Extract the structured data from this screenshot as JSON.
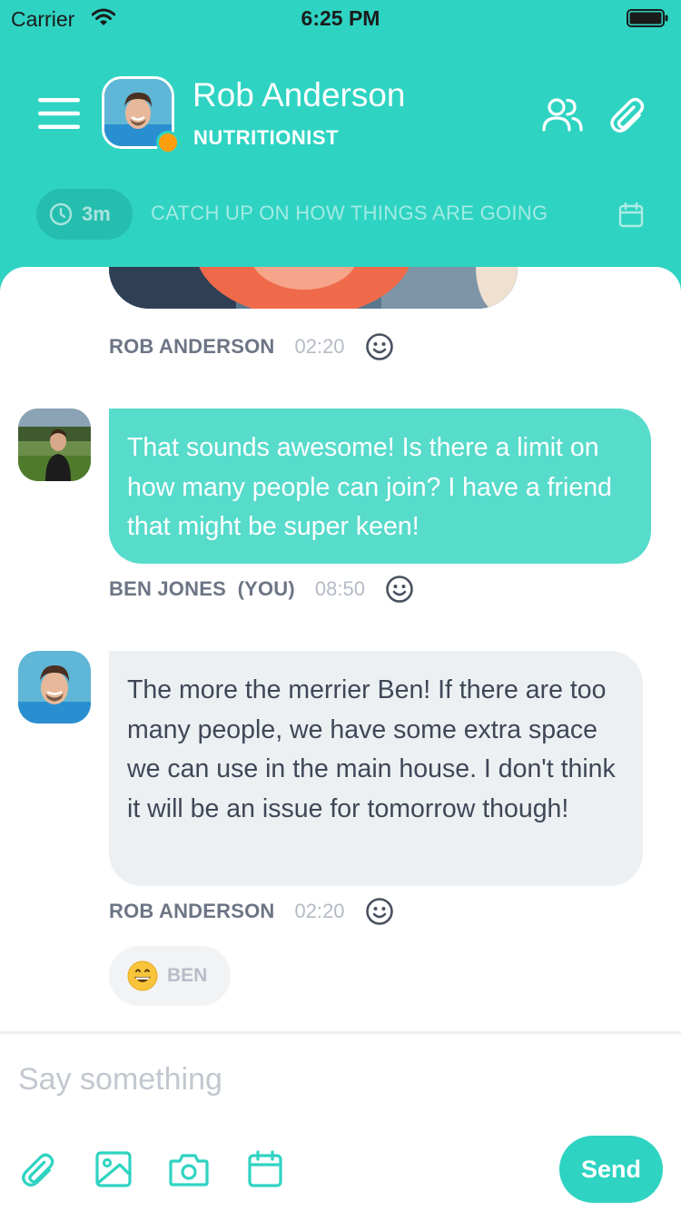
{
  "status_bar": {
    "carrier": "Carrier",
    "time": "6:25 PM"
  },
  "header": {
    "contact_name": "Rob Anderson",
    "contact_role": "NUTRITIONIST",
    "online_status_color": "#ff9f0f",
    "session": {
      "timer": "3m",
      "topic": "CATCH UP ON HOW THINGS ARE GOING"
    }
  },
  "colors": {
    "accent": "#2fd3c2",
    "my_bubble": "#57dbcb",
    "their_bubble": "#edf0f3"
  },
  "messages": [
    {
      "type": "image",
      "author": "ROB ANDERSON",
      "time": "02:20"
    },
    {
      "type": "text",
      "author": "BEN JONES  (YOU)",
      "time": "08:50",
      "text": "That sounds awesome! Is there a limit on how many people can join? I have a friend that might be super keen!"
    },
    {
      "type": "text",
      "author": "ROB ANDERSON",
      "time": "02:20",
      "text": "The more the merrier Ben! If there are too many people, we have some extra space we can use in the main house. I don't think it will be an issue for tomorrow though!",
      "reaction": {
        "emoji": "grinning-face",
        "by": "BEN"
      }
    }
  ],
  "composer": {
    "placeholder": "Say something",
    "send_label": "Send"
  },
  "icons": [
    "menu-icon",
    "people-icon",
    "paperclip-icon",
    "clock-icon",
    "calendar-icon",
    "smiley-icon",
    "image-icon",
    "camera-icon"
  ]
}
